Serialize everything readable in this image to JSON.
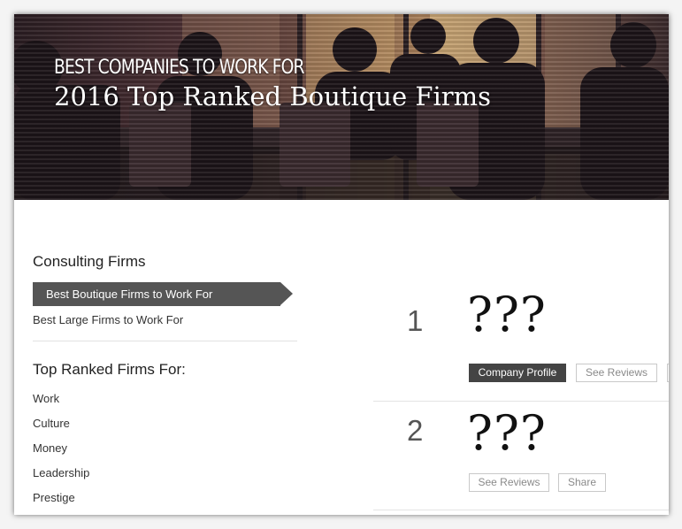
{
  "hero": {
    "kicker": "BEST COMPANIES TO WORK FOR",
    "title": "2016 Top Ranked Boutique Firms"
  },
  "sidebar": {
    "section1_heading": "Consulting Firms",
    "active_item": "Best Boutique Firms to Work For",
    "other_item": "Best Large Firms to Work For",
    "section2_heading": "Top Ranked Firms For:",
    "categories": [
      "Work",
      "Culture",
      "Money",
      "Leadership",
      "Prestige"
    ]
  },
  "rankings": [
    {
      "rank": "1",
      "name": "???",
      "buttons": [
        "Company Profile",
        "See Reviews"
      ]
    },
    {
      "rank": "2",
      "name": "???",
      "buttons": [
        "See Reviews",
        "Share"
      ]
    }
  ],
  "colors": {
    "active_nav": "#555555",
    "primary_button": "#444444"
  }
}
